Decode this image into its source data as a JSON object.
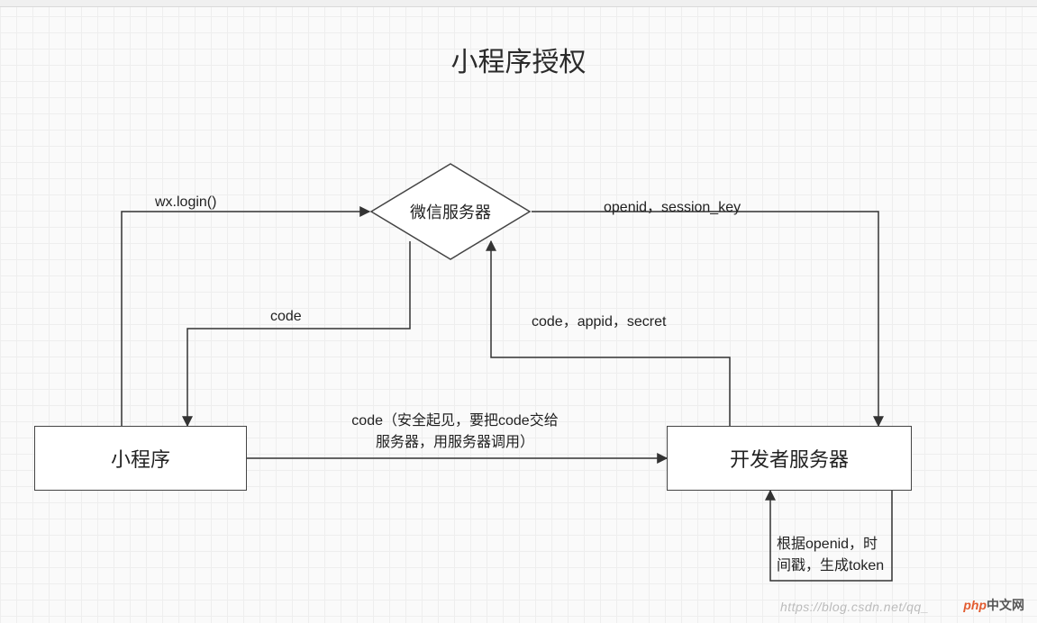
{
  "title": "小程序授权",
  "nodes": {
    "miniprogram": {
      "label": "小程序"
    },
    "wechat_server": {
      "label": "微信服务器"
    },
    "dev_server": {
      "label": "开发者服务器"
    }
  },
  "edges": {
    "wx_login": {
      "label": "wx.login()"
    },
    "code_return": {
      "label": "code"
    },
    "code_to_dev": {
      "label": "code（安全起见，要把code交给\n服务器，用服务器调用）"
    },
    "dev_to_wechat": {
      "label": "code，appid，secret"
    },
    "wechat_to_dev": {
      "label": "openid，session_key"
    },
    "dev_self": {
      "label": "根据openid，时\n间戳，生成token"
    }
  },
  "watermark": "https://blog.csdn.net/qq_",
  "brand": {
    "php": "php",
    "cn": "中文网"
  },
  "chart_data": {
    "type": "flowchart",
    "title": "小程序授权",
    "nodes": [
      {
        "id": "miniprogram",
        "label": "小程序",
        "shape": "rect"
      },
      {
        "id": "wechat_server",
        "label": "微信服务器",
        "shape": "diamond"
      },
      {
        "id": "dev_server",
        "label": "开发者服务器",
        "shape": "rect"
      }
    ],
    "edges": [
      {
        "from": "miniprogram",
        "to": "wechat_server",
        "label": "wx.login()"
      },
      {
        "from": "wechat_server",
        "to": "miniprogram",
        "label": "code"
      },
      {
        "from": "miniprogram",
        "to": "dev_server",
        "label": "code（安全起见，要把code交给服务器，用服务器调用）"
      },
      {
        "from": "dev_server",
        "to": "wechat_server",
        "label": "code，appid，secret"
      },
      {
        "from": "wechat_server",
        "to": "dev_server",
        "label": "openid，session_key"
      },
      {
        "from": "dev_server",
        "to": "dev_server",
        "label": "根据openid，时间戳，生成token"
      }
    ]
  }
}
